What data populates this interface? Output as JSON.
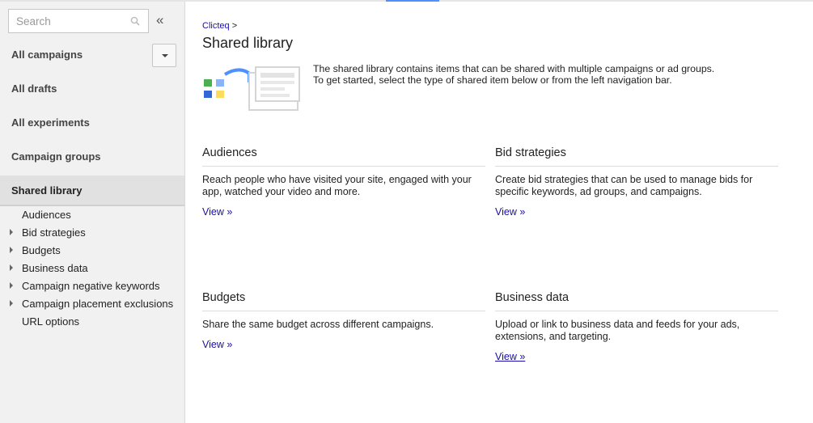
{
  "search": {
    "placeholder": "Search"
  },
  "sidebar": {
    "collapse_glyph": "«",
    "nav": [
      {
        "label": "All campaigns"
      },
      {
        "label": "All drafts"
      },
      {
        "label": "All experiments"
      },
      {
        "label": "Campaign groups"
      },
      {
        "label": "Shared library"
      }
    ],
    "sub_items": [
      {
        "label": "Audiences",
        "expandable": false
      },
      {
        "label": "Bid strategies",
        "expandable": true
      },
      {
        "label": "Budgets",
        "expandable": true
      },
      {
        "label": "Business data",
        "expandable": true
      },
      {
        "label": "Campaign negative keywords",
        "expandable": true
      },
      {
        "label": "Campaign placement exclusions",
        "expandable": true
      },
      {
        "label": "URL options",
        "expandable": false
      }
    ]
  },
  "main": {
    "breadcrumb": {
      "link": "Clicteq",
      "separator": ">"
    },
    "title": "Shared library",
    "intro": "The shared library contains items that can be shared with multiple campaigns or ad groups. To get started, select the type of shared item below or from the left navigation bar.",
    "cards": [
      {
        "title": "Audiences",
        "description": "Reach people who have visited your site, engaged with your app, watched your video and more.",
        "link": "View »"
      },
      {
        "title": "Bid strategies",
        "description": "Create bid strategies that can be used to manage bids for specific keywords, ad groups, and campaigns.",
        "link": "View »"
      },
      {
        "title": "Budgets",
        "description": "Share the same budget across different campaigns.",
        "link": "View »"
      },
      {
        "title": "Business data",
        "description": "Upload or link to business data and feeds for your ads, extensions, and targeting.",
        "link": "View »"
      }
    ]
  },
  "colors": {
    "link": "#1a0dab",
    "accent": "#4d90fe",
    "sidebar_bg": "#f1f1f1",
    "active_bg": "#e1e1e1"
  },
  "icons": {
    "search": "search-icon",
    "collapse": "double-chevron-left-icon",
    "dropdown": "caret-down-icon",
    "expand": "triangle-right-icon"
  }
}
